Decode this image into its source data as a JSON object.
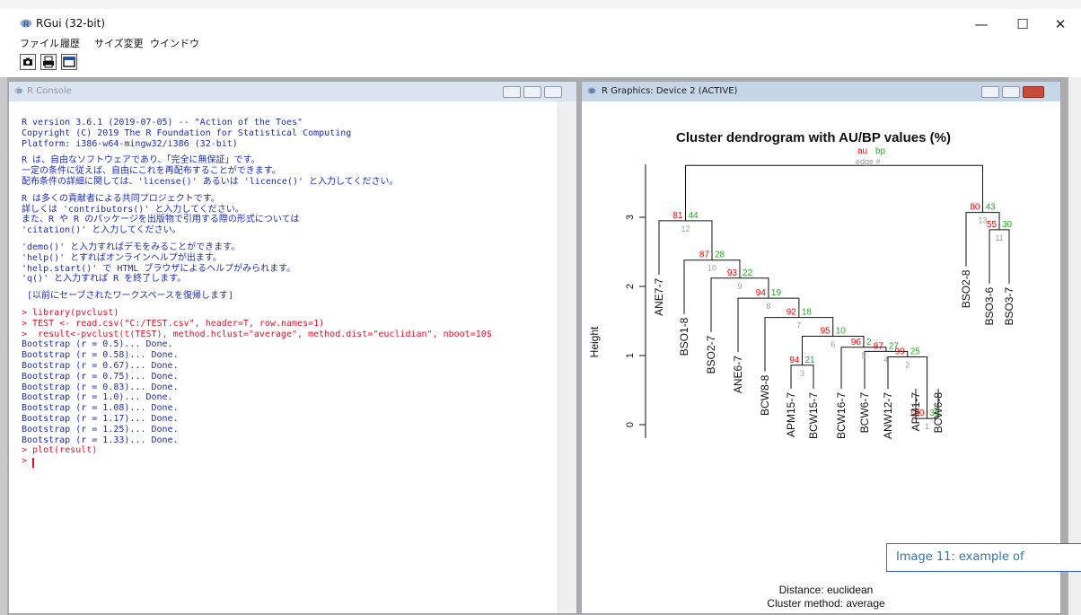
{
  "window": {
    "title": "RGui (32-bit)",
    "minimize": "—",
    "maximize": "☐",
    "close": "✕"
  },
  "menu": {
    "items": [
      "ファイル",
      "履歴",
      "サイズ変更",
      "ウインドウ"
    ]
  },
  "toolbar": {
    "icons": [
      "camera-icon",
      "print-icon",
      "window-icon"
    ]
  },
  "console": {
    "title": "R Console",
    "lines": [
      {
        "text": "R version 3.6.1 (2019-07-05) -- \"Action of the Toes\"",
        "color": "blue"
      },
      {
        "text": "Copyright (C) 2019 The R Foundation for Statistical Computing",
        "color": "blue"
      },
      {
        "text": "Platform: i386-w64-mingw32/i386 (32-bit)",
        "color": "blue"
      },
      {
        "text": "",
        "color": "blue"
      },
      {
        "text": "R は、自由なソフトウェアであり、「完全に無保証」です。",
        "color": "blue"
      },
      {
        "text": "一定の条件に従えば、自由にこれを再配布することができます。",
        "color": "blue"
      },
      {
        "text": "配布条件の詳細に関しては、'license()' あるいは 'licence()' と入力してください。",
        "color": "blue"
      },
      {
        "text": "",
        "color": "blue"
      },
      {
        "text": "R は多くの貢献者による共同プロジェクトです。",
        "color": "blue"
      },
      {
        "text": "詳しくは 'contributors()' と入力してください。",
        "color": "blue"
      },
      {
        "text": "また、R や R のパッケージを出版物で引用する際の形式については",
        "color": "blue"
      },
      {
        "text": "'citation()' と入力してください。",
        "color": "blue"
      },
      {
        "text": "",
        "color": "blue"
      },
      {
        "text": "'demo()' と入力すればデモをみることができます。",
        "color": "blue"
      },
      {
        "text": "'help()' とすればオンラインヘルプが出ます。",
        "color": "blue"
      },
      {
        "text": "'help.start()' で HTML ブラウザによるヘルプがみられます。",
        "color": "blue"
      },
      {
        "text": "'q()' と入力すれば R を終了します。",
        "color": "blue"
      },
      {
        "text": "",
        "color": "blue"
      },
      {
        "text": " [以前にセーブされたワークスペースを復帰します]",
        "color": "blue"
      },
      {
        "text": "",
        "color": "blue"
      },
      {
        "text": "> library(pvclust)",
        "color": "red"
      },
      {
        "text": "> TEST <- read.csv(\"C:/TEST.csv\", header=T, row.names=1)",
        "color": "red"
      },
      {
        "text": ">  result<-pvclust(t(TEST), method.hclust=\"average\", method.dist=\"euclidian\", nboot=10$",
        "color": "red"
      },
      {
        "text": "Bootstrap (r = 0.5)... Done.",
        "color": "blue"
      },
      {
        "text": "Bootstrap (r = 0.58)... Done.",
        "color": "blue"
      },
      {
        "text": "Bootstrap (r = 0.67)... Done.",
        "color": "blue"
      },
      {
        "text": "Bootstrap (r = 0.75)... Done.",
        "color": "blue"
      },
      {
        "text": "Bootstrap (r = 0.83)... Done.",
        "color": "blue"
      },
      {
        "text": "Bootstrap (r = 1.0)... Done.",
        "color": "blue"
      },
      {
        "text": "Bootstrap (r = 1.08)... Done.",
        "color": "blue"
      },
      {
        "text": "Bootstrap (r = 1.17)... Done.",
        "color": "blue"
      },
      {
        "text": "Bootstrap (r = 1.25)... Done.",
        "color": "blue"
      },
      {
        "text": "Bootstrap (r = 1.33)... Done.",
        "color": "blue"
      },
      {
        "text": "> plot(result)",
        "color": "red"
      },
      {
        "text": "> ",
        "color": "red"
      }
    ]
  },
  "graphics": {
    "title": "R Graphics: Device 2 (ACTIVE)",
    "plot_title": "Cluster dendrogram with AU/BP values (%)",
    "ylabel": "Height",
    "yticks": [
      "0",
      "1",
      "2",
      "3"
    ],
    "legend": {
      "au": "au",
      "bp": "bp",
      "edge": "edge #"
    },
    "footer1": "Distance:  euclidean",
    "footer2": "Cluster method: average",
    "leaves": [
      "ANE7-7",
      "BSO1-8",
      "BSO2-7",
      "ANE6-7",
      "BCW8-8",
      "APM15-7",
      "BCW15-7",
      "BCW16-7",
      "BCW6-7",
      "ANW12-7",
      "APM1-7",
      "BCW6-8",
      "BSO2-8",
      "BSO3-6",
      "BSO3-7"
    ],
    "nodes": [
      {
        "au": "81",
        "bp": "44",
        "edge": "12"
      },
      {
        "au": "87",
        "bp": "28",
        "edge": "10"
      },
      {
        "au": "93",
        "bp": "22",
        "edge": "9"
      },
      {
        "au": "94",
        "bp": "19",
        "edge": "8"
      },
      {
        "au": "92",
        "bp": "18",
        "edge": "7"
      },
      {
        "au": "95",
        "bp": "10",
        "edge": "6"
      },
      {
        "au": "94",
        "bp": "21",
        "edge": "3"
      },
      {
        "au": "96",
        "bp": "2",
        "edge": "5"
      },
      {
        "au": "87",
        "bp": "27",
        "edge": "4"
      },
      {
        "au": "99",
        "bp": "25",
        "edge": "2"
      },
      {
        "au": "100",
        "bp": "35",
        "edge": "1"
      },
      {
        "au": "80",
        "bp": "43",
        "edge": "13"
      },
      {
        "au": "55",
        "bp": "30",
        "edge": "11"
      }
    ]
  },
  "caption": "Image 11: example of",
  "colors": {
    "au": "#ff0000",
    "bp": "#22aa22",
    "edge": "#999999",
    "console_blue": "#1c2db4",
    "console_red": "#e0102a"
  }
}
